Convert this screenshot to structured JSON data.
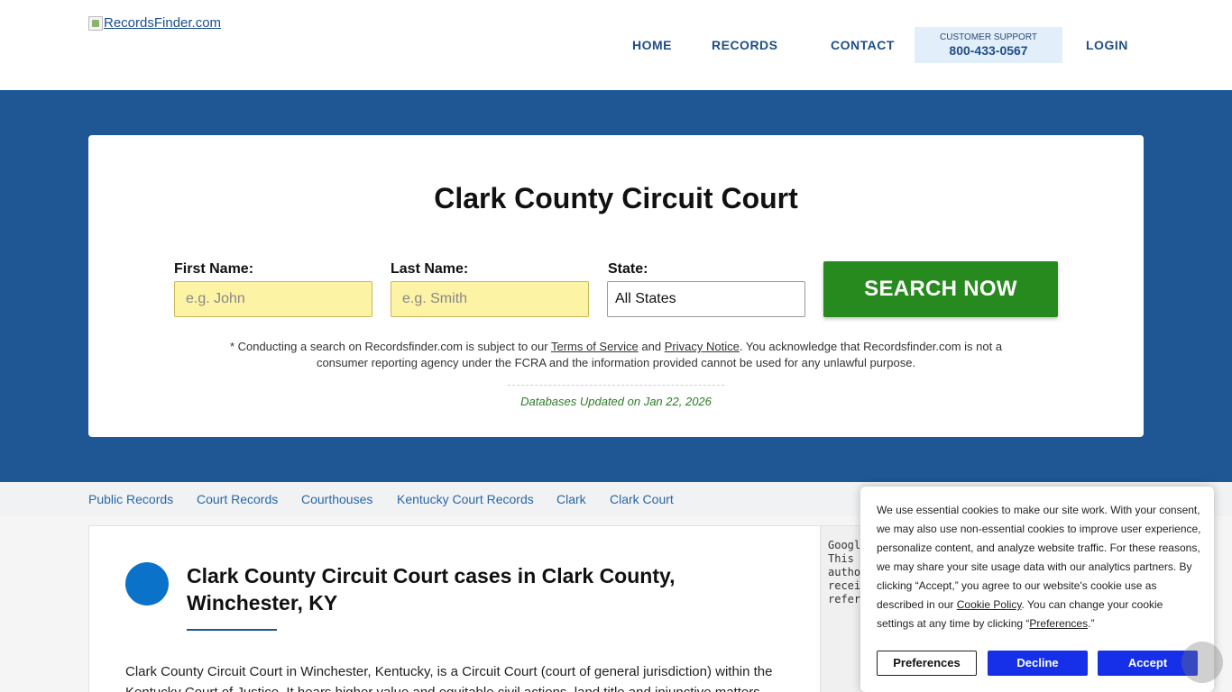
{
  "header": {
    "logo_text": "RecordsFinder.com",
    "nav": {
      "home": "HOME",
      "records": "RECORDS",
      "contact": "CONTACT",
      "login": "LOGIN"
    },
    "support": {
      "label": "CUSTOMER SUPPORT",
      "phone": "800-433-0567"
    }
  },
  "hero": {
    "title": "Clark County Circuit Court",
    "form": {
      "first_name_label": "First Name:",
      "first_name_placeholder": "e.g. John",
      "last_name_label": "Last Name:",
      "last_name_placeholder": "e.g. Smith",
      "state_label": "State:",
      "state_value": "All States",
      "search_button": "SEARCH NOW"
    },
    "disclaimer": {
      "prefix": "* Conducting a search on Recordsfinder.com is subject to our",
      "terms_link": "Terms of Service",
      "and": "and",
      "privacy_link": "Privacy Notice",
      "suffix": ". You acknowledge that Recordsfinder.com is not a consumer reporting agency under the FCRA and the information provided cannot be used for any unlawful purpose."
    },
    "db_updated": "Databases Updated on Jan 22, 2026"
  },
  "breadcrumb": [
    "Public Records",
    "Court Records",
    "Courthouses",
    "Kentucky Court Records",
    "Clark",
    "Clark Court"
  ],
  "article": {
    "title": "Clark County Circuit Court cases in Clark County, Winchester, KY",
    "body": "Clark County Circuit Court in Winchester, Kentucky, is a Circuit Court (court of general jurisdiction) within the Kentucky Court of Justice. It hears higher value and equitable civil actions, land title and injunctive matters."
  },
  "side_ad": {
    "text": "Googl\nThis \nautho\nrecei\nrefer"
  },
  "cookie": {
    "text_1": "We use essential cookies to make our site work. With your consent, we may also use non-essential cookies to improve user experience, personalize content, and analyze website traffic. For these reasons, we may share your site usage data with our analytics partners. By clicking “Accept,” you agree to our website's cookie use as described in our",
    "policy_link": "Cookie Policy",
    "text_2": ". You can change your cookie settings at any time by clicking “",
    "pref_link": "Preferences",
    "text_3": ".”",
    "preferences_button": "Preferences",
    "decline_button": "Decline",
    "accept_button": "Accept"
  },
  "colors": {
    "brand_blue": "#1f5694",
    "search_green": "#278a1f",
    "input_yellow": "#fdf3a4",
    "cookie_button_blue": "#1530e8"
  }
}
